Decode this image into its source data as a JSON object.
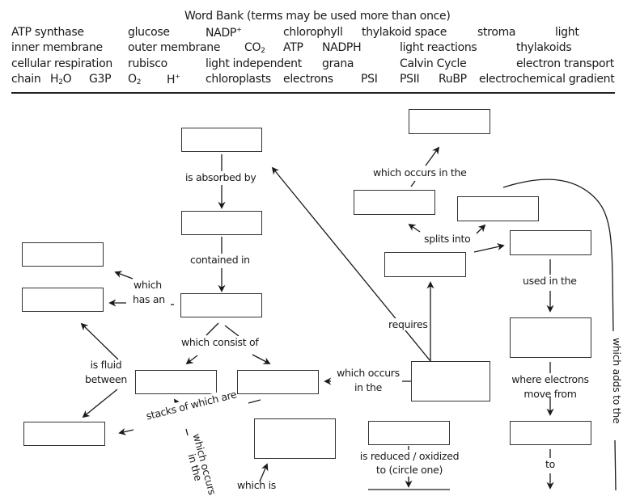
{
  "word_bank": {
    "title": "Word Bank (terms may be used more than once)",
    "terms": [
      {
        "text": "ATP synthase"
      },
      {
        "text": "glucose"
      },
      {
        "text": "NADP",
        "sup": "+"
      },
      {
        "text": "chlorophyll"
      },
      {
        "text": "thylakoid space"
      },
      {
        "text": "stroma"
      },
      {
        "text": "light"
      },
      {
        "text": "inner membrane"
      },
      {
        "text": "outer membrane"
      },
      {
        "text": "CO",
        "sub": "2"
      },
      {
        "text": "ATP"
      },
      {
        "text": "NADPH"
      },
      {
        "text": "light reactions"
      },
      {
        "text": "thylakoids"
      },
      {
        "text": "cellular respiration"
      },
      {
        "text": "rubisco"
      },
      {
        "text": "light independent"
      },
      {
        "text": "grana"
      },
      {
        "text": "Calvin Cycle"
      },
      {
        "text": "electron transport"
      },
      {
        "text": "chain"
      },
      {
        "text": "H",
        "sub": "2",
        "after": "O"
      },
      {
        "text": "G3P"
      },
      {
        "text": "O",
        "sub": "2"
      },
      {
        "text": "H",
        "sup": "+"
      },
      {
        "text": "chloroplasts"
      },
      {
        "text": "electrons"
      },
      {
        "text": "PSI"
      },
      {
        "text": "PSII"
      },
      {
        "text": "RuBP"
      },
      {
        "text": "electrochemical gradient"
      }
    ]
  },
  "concept_map": {
    "boxes": [
      {
        "id": "light-box",
        "value": ""
      },
      {
        "id": "absorber-box",
        "value": ""
      },
      {
        "id": "container-box",
        "value": ""
      },
      {
        "id": "membrane-top-box",
        "value": ""
      },
      {
        "id": "membrane-bottom-box",
        "value": ""
      },
      {
        "id": "part-left-box",
        "value": ""
      },
      {
        "id": "part-right-box",
        "value": ""
      },
      {
        "id": "fluid-box",
        "value": ""
      },
      {
        "id": "thylakoid-space-box",
        "value": ""
      },
      {
        "id": "top-right-box",
        "value": ""
      },
      {
        "id": "split-left-box",
        "value": ""
      },
      {
        "id": "split-middle-box",
        "value": ""
      },
      {
        "id": "split-right-box",
        "value": ""
      },
      {
        "id": "water-box",
        "value": ""
      },
      {
        "id": "light-reactions-box",
        "value": ""
      },
      {
        "id": "used-in-box",
        "value": ""
      },
      {
        "id": "move-from-box",
        "value": ""
      },
      {
        "id": "reduced-box",
        "value": ""
      }
    ],
    "labels": {
      "is_absorbed_by": "is absorbed by",
      "contained_in": "contained in",
      "which": "which",
      "has_an": "has an",
      "which_consist_of": "which consist of",
      "is_fluid": "is fluid",
      "between": "between",
      "stacks_of_which_are": "stacks of which are",
      "which_occurs": "which occurs",
      "in_the": "in the",
      "which_is": "which is",
      "which_occurs_in_the": "which occurs in the",
      "splits_into": "splits into",
      "requires": "requires",
      "which_occurs_right": "which occurs",
      "in_the_right": "in the",
      "used_in_the": "used in the",
      "where_electrons": "where electrons",
      "move_from": "move from",
      "is_reduced_oxidized": "is reduced / oxidized",
      "to_circle_one": "to (circle one)",
      "to": "to",
      "which_adds_to_the": "which adds to the"
    }
  }
}
